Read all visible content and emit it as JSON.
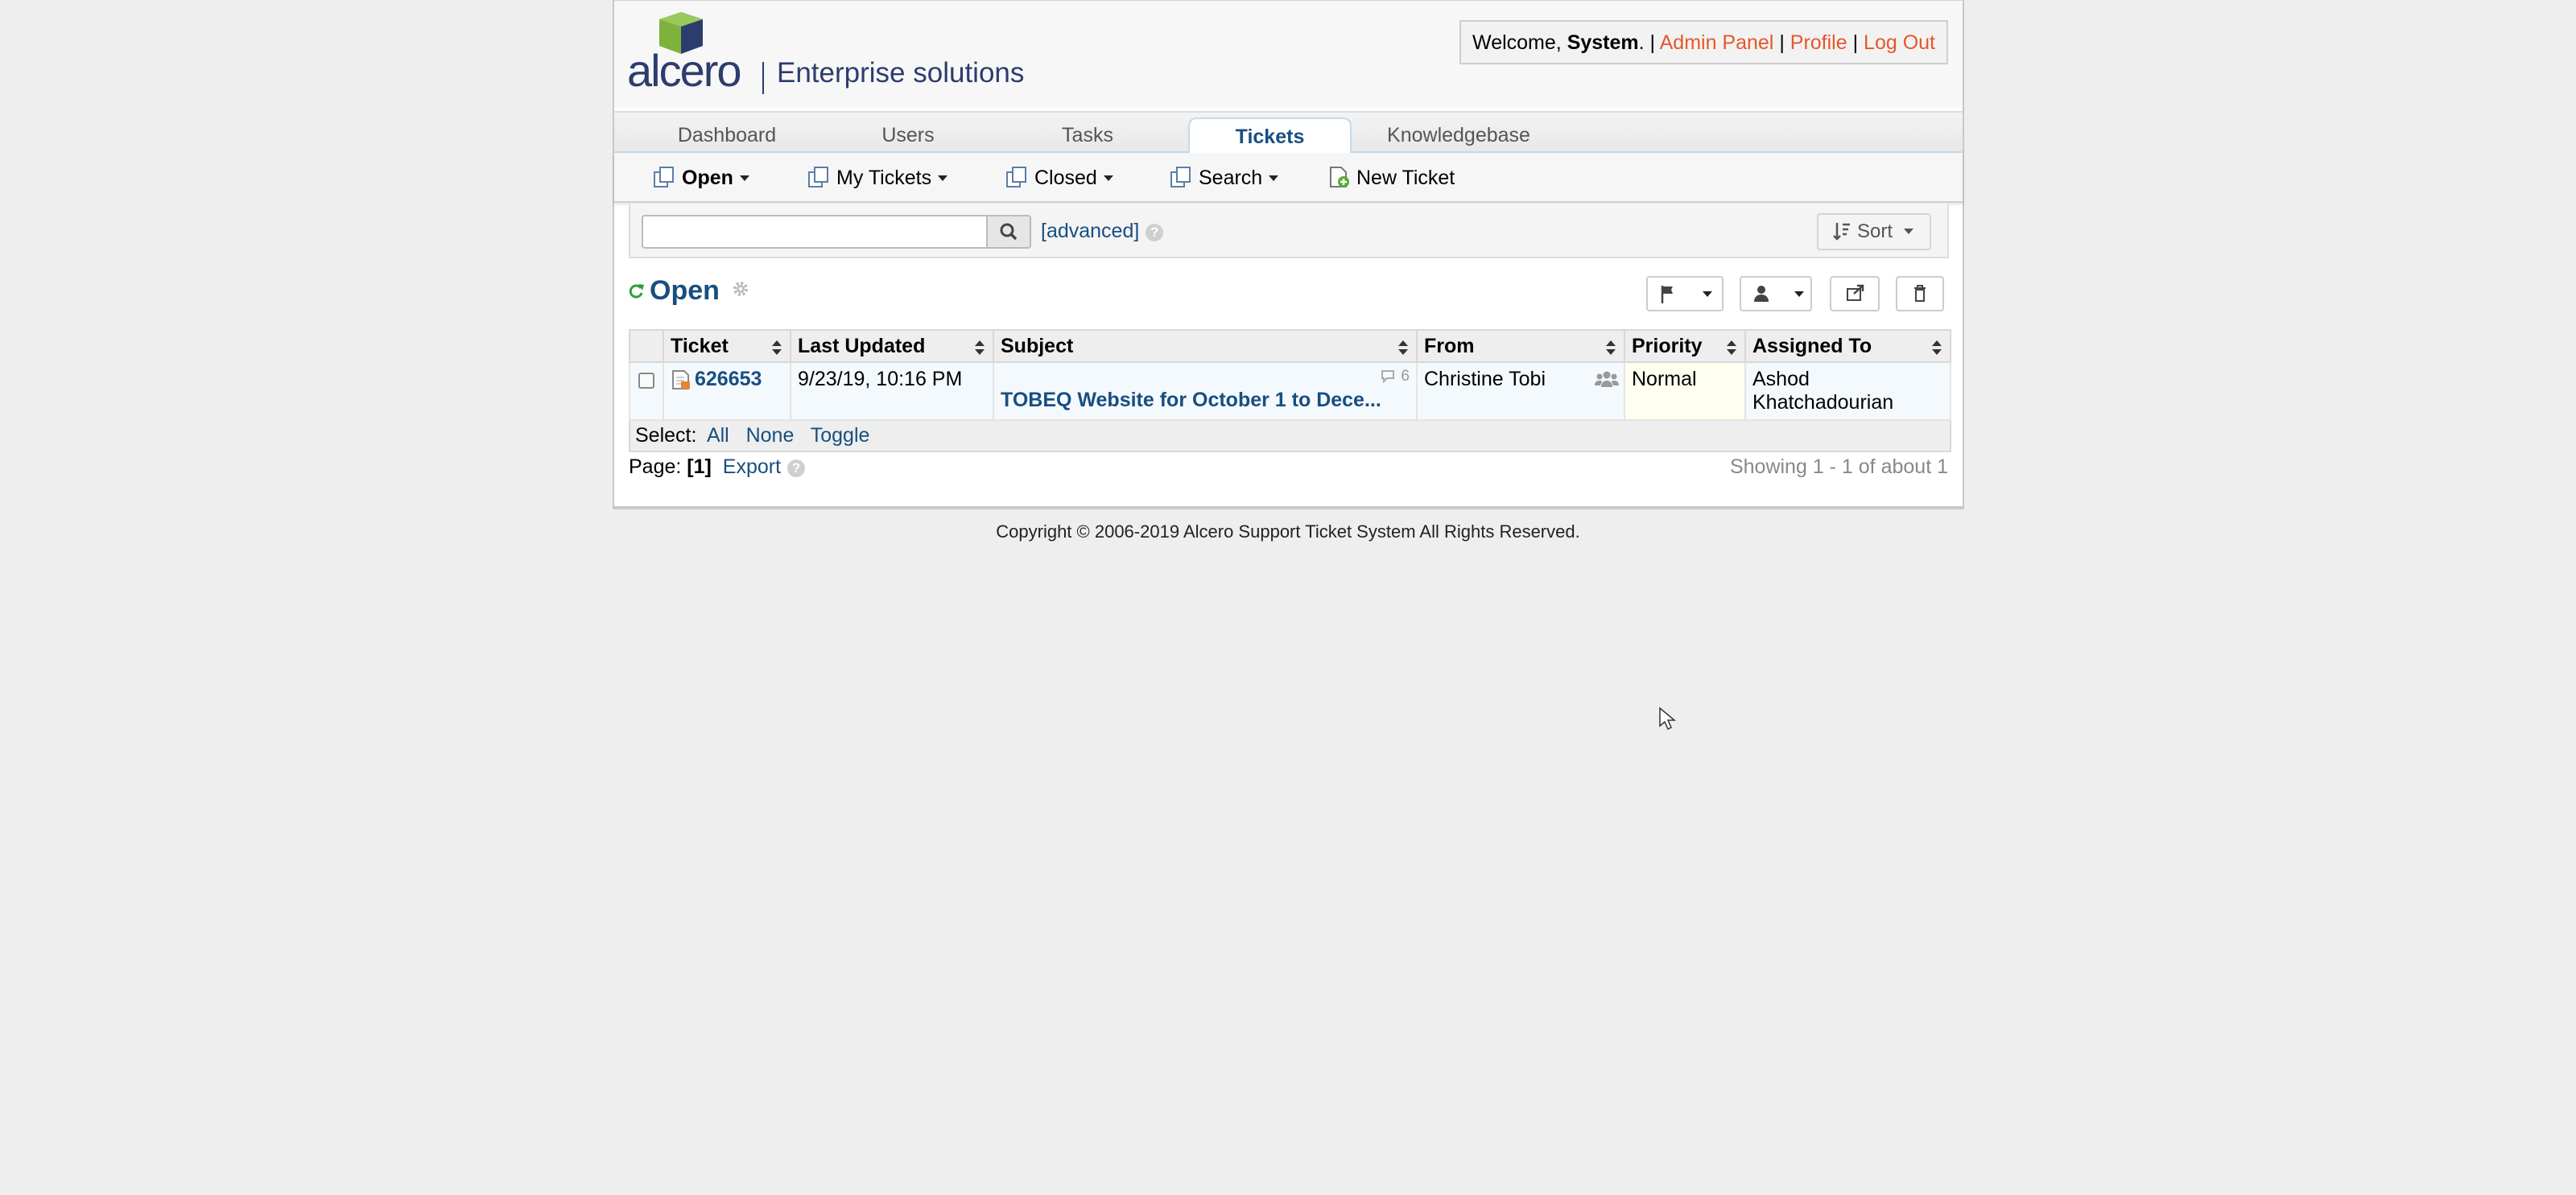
{
  "header": {
    "brand": "alcero",
    "tagline": "Enterprise solutions",
    "welcome_prefix": "Welcome, ",
    "user_name": "System",
    "welcome_suffix": ". |",
    "admin_panel": "Admin Panel",
    "profile": "Profile",
    "logout": "Log Out",
    "sep": "|"
  },
  "nav": {
    "tabs": [
      {
        "label": "Dashboard"
      },
      {
        "label": "Users"
      },
      {
        "label": "Tasks"
      },
      {
        "label": "Tickets",
        "active": true
      },
      {
        "label": "Knowledgebase"
      }
    ]
  },
  "subnav": {
    "open": "Open",
    "my_tickets": "My Tickets",
    "closed": "Closed",
    "search": "Search",
    "new_ticket": "New Ticket"
  },
  "search": {
    "value": "",
    "advanced": "[advanced]",
    "sort": "Sort"
  },
  "queue": {
    "title": "Open"
  },
  "table": {
    "headers": [
      "Ticket",
      "Last Updated",
      "Subject",
      "From",
      "Priority",
      "Assigned To"
    ],
    "rows": [
      {
        "ticket": "626653",
        "last_updated": "9/23/19, 10:16 PM",
        "thread_count": "6",
        "subject": "TOBEQ Website for October 1 to Dece...",
        "from": "Christine Tobi",
        "priority": "Normal",
        "assigned_line1": "Ashod",
        "assigned_line2": "Khatchadourian"
      }
    ],
    "select_label": "Select:",
    "select_all": "All",
    "select_none": "None",
    "select_toggle": "Toggle"
  },
  "pager": {
    "page_label": "Page:",
    "page_current": "[1]",
    "export": "Export",
    "showing": "Showing 1 - 1 of about 1"
  },
  "footer": {
    "copyright": "Copyright © 2006-2019 Alcero Support Ticket System All Rights Reserved."
  },
  "colors": {
    "brand_blue": "#2d3c6e",
    "brand_green": "#7fb23c",
    "link_blue": "#184e81",
    "link_orange": "#e6572b"
  }
}
